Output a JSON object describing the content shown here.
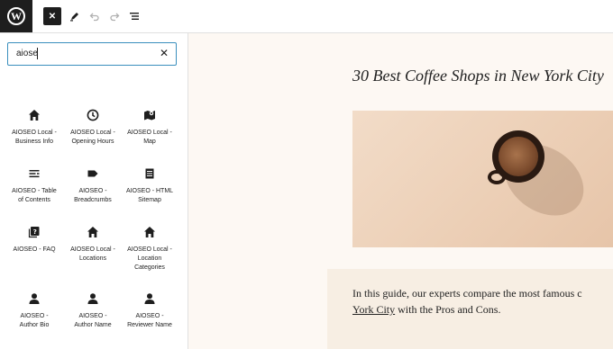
{
  "toolbar": {
    "logo_letter": "W",
    "close_symbol": "✕",
    "pencil_icon": "pencil-icon",
    "undo_icon": "undo-icon",
    "redo_icon": "redo-icon",
    "list_icon": "list-view-icon"
  },
  "inserter": {
    "search_value": "aiose",
    "clear_symbol": "✕",
    "blocks": [
      {
        "line1": "AIOSEO Local -",
        "line2": "Business Info",
        "line3": "",
        "icon": "house-icon"
      },
      {
        "line1": "AIOSEO Local -",
        "line2": "Opening Hours",
        "line3": "",
        "icon": "clock-icon"
      },
      {
        "line1": "AIOSEO Local -",
        "line2": "Map",
        "line3": "",
        "icon": "map-icon"
      },
      {
        "line1": "AIOSEO - Table",
        "line2": "of Contents",
        "line3": "",
        "icon": "table-of-contents-icon"
      },
      {
        "line1": "AIOSEO -",
        "line2": "Breadcrumbs",
        "line3": "",
        "icon": "breadcrumbs-icon"
      },
      {
        "line1": "AIOSEO - HTML",
        "line2": "Sitemap",
        "line3": "",
        "icon": "sitemap-icon"
      },
      {
        "line1": "AIOSEO - FAQ",
        "line2": "",
        "line3": "",
        "icon": "faq-icon"
      },
      {
        "line1": "AIOSEO Local -",
        "line2": "Locations",
        "line3": "",
        "icon": "house-icon"
      },
      {
        "line1": "AIOSEO Local -",
        "line2": "Location",
        "line3": "Categories",
        "icon": "house-icon"
      },
      {
        "line1": "AIOSEO -",
        "line2": "Author Bio",
        "line3": "",
        "icon": "person-icon"
      },
      {
        "line1": "AIOSEO -",
        "line2": "Author Name",
        "line3": "",
        "icon": "person-icon"
      },
      {
        "line1": "AIOSEO -",
        "line2": "Reviewer Name",
        "line3": "",
        "icon": "person-icon"
      }
    ]
  },
  "post": {
    "title": "30 Best Coffee Shops in New York City",
    "paragraph_line1": "In this guide, our experts compare the most famous c",
    "paragraph_link": "York City",
    "paragraph_line2_rest": " with the Pros and Cons."
  }
}
